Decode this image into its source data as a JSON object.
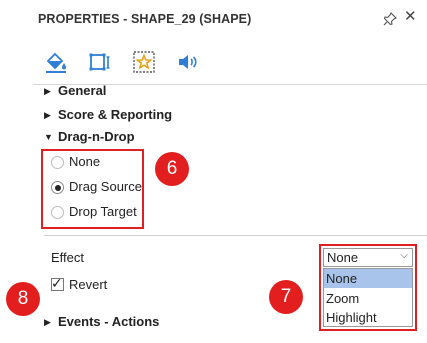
{
  "header": {
    "title": "PROPERTIES - SHAPE_29 (SHAPE)"
  },
  "toolbar": {
    "icons": [
      "paint-bucket-icon",
      "text-box-icon",
      "star-box-icon",
      "speaker-icon"
    ]
  },
  "sections": {
    "general": "General",
    "score": "Score & Reporting",
    "dnd": "Drag-n-Drop",
    "events": "Events - Actions"
  },
  "dnd_options": {
    "none": "None",
    "source": "Drag Source",
    "target": "Drop Target",
    "selected": "Drag Source"
  },
  "effect": {
    "label": "Effect",
    "value": "None",
    "options": [
      "None",
      "Zoom",
      "Highlight"
    ]
  },
  "revert": {
    "label": "Revert",
    "checked": true
  },
  "badges": {
    "b6": "6",
    "b7": "7",
    "b8": "8"
  },
  "colors": {
    "annotation_red": "#e21e1e",
    "highlight": "#a9c4ea",
    "accent_blue": "#2f7fd6"
  }
}
